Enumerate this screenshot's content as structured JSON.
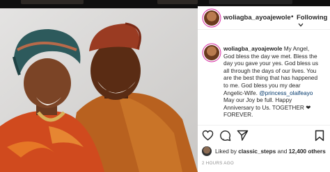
{
  "post": {
    "username": "woliagba_ayoajewole",
    "follow_label": "Following",
    "separator": "•",
    "caption_lines": [
      "My Angel,",
      "God bless the day we met. Bless the",
      "day you gave your yes. God bless us",
      "all through the days of our lives. You",
      "are the best thing that has happened",
      "to me. God bless you my dear",
      "Angelic-Wife.",
      "May our Joy be full. Happy",
      "Anniversary to Us. TOGETHER",
      "FOREVER."
    ],
    "caption_mention": "@princess_olaifeayo",
    "caption_heart": "❤",
    "comment_placeholder": ".",
    "likes": {
      "prefix": "Liked by",
      "user": "classic_steps",
      "conjunction": "and",
      "count_text": "12,400 others"
    },
    "timestamp": "2 HOURS AGO"
  },
  "icons": {
    "like": "heart-icon",
    "comment": "comment-icon",
    "share": "share-icon",
    "save": "bookmark-icon",
    "chevron": "chevron-down-icon"
  },
  "colors": {
    "mention": "#00376b",
    "text": "#262626",
    "muted": "#8e8e8e",
    "story_ring": "#d6249f"
  }
}
